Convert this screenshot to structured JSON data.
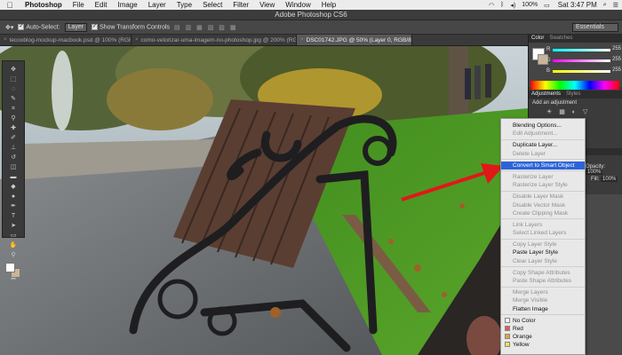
{
  "menubar": {
    "apple_icon": "",
    "app_name": "Photoshop",
    "items": [
      "File",
      "Edit",
      "Image",
      "Layer",
      "Type",
      "Select",
      "Filter",
      "View",
      "Window",
      "Help"
    ],
    "battery": "100%",
    "clock": "Sat 3:47 PM"
  },
  "app_title": "Adobe Photoshop CS6",
  "options": {
    "auto_select_label": "Auto-Select:",
    "auto_select_value": "Layer",
    "transform_label": "Show Transform Controls",
    "workspace": "Essentials"
  },
  "tabs": [
    {
      "label": "tecooblog-mockup-macbook.psd @ 100% (RGB/8)",
      "active": false
    },
    {
      "label": "como-vetorizar-uma-imagem-no-photoshop.jpg @ 200% (RGB/8)",
      "active": false
    },
    {
      "label": "DSC01742.JPG @ 50% (Layer 0, RGB/8)",
      "active": true
    }
  ],
  "panels": {
    "color_tab": "Color",
    "swatches_tab": "Swatches",
    "channels": [
      {
        "label": "R",
        "value": "255"
      },
      {
        "label": "G",
        "value": "255"
      },
      {
        "label": "B",
        "value": "255"
      }
    ],
    "adjustments_tab": "Adjustments",
    "styles_tab": "Styles",
    "add_adjustment": "Add an adjustment",
    "opacity_label": "Opacity:",
    "opacity_value": "100%",
    "fill_label": "Fill:",
    "fill_value": "100%"
  },
  "context_menu": {
    "items": [
      {
        "label": "Blending Options...",
        "enabled": true
      },
      {
        "label": "Edit Adjustment...",
        "enabled": false
      },
      {
        "sep": true
      },
      {
        "label": "Duplicate Layer...",
        "enabled": true
      },
      {
        "label": "Delete Layer",
        "enabled": false
      },
      {
        "sep": true
      },
      {
        "label": "Convert to Smart Object",
        "enabled": true,
        "highlighted": true
      },
      {
        "sep": true
      },
      {
        "label": "Rasterize Layer",
        "enabled": false
      },
      {
        "label": "Rasterize Layer Style",
        "enabled": false
      },
      {
        "sep": true
      },
      {
        "label": "Disable Layer Mask",
        "enabled": false
      },
      {
        "label": "Disable Vector Mask",
        "enabled": false
      },
      {
        "label": "Create Clipping Mask",
        "enabled": false
      },
      {
        "sep": true
      },
      {
        "label": "Link Layers",
        "enabled": false
      },
      {
        "label": "Select Linked Layers",
        "enabled": false
      },
      {
        "sep": true
      },
      {
        "label": "Copy Layer Style",
        "enabled": false
      },
      {
        "label": "Paste Layer Style",
        "enabled": true
      },
      {
        "label": "Clear Layer Style",
        "enabled": false
      },
      {
        "sep": true
      },
      {
        "label": "Copy Shape Attributes",
        "enabled": false
      },
      {
        "label": "Paste Shape Attributes",
        "enabled": false
      },
      {
        "sep": true
      },
      {
        "label": "Merge Layers",
        "enabled": false
      },
      {
        "label": "Merge Visible",
        "enabled": false
      },
      {
        "label": "Flatten Image",
        "enabled": true
      },
      {
        "sep": true
      },
      {
        "label": "No Color",
        "enabled": true,
        "swatch": "none"
      },
      {
        "label": "Red",
        "enabled": true,
        "swatch": "#e05a5a"
      },
      {
        "label": "Orange",
        "enabled": true,
        "swatch": "#f0a040"
      },
      {
        "label": "Yellow",
        "enabled": true,
        "swatch": "#f0e050"
      }
    ]
  },
  "colors": {
    "highlight": "#2d63d8",
    "annotation_arrow": "#e01818"
  }
}
